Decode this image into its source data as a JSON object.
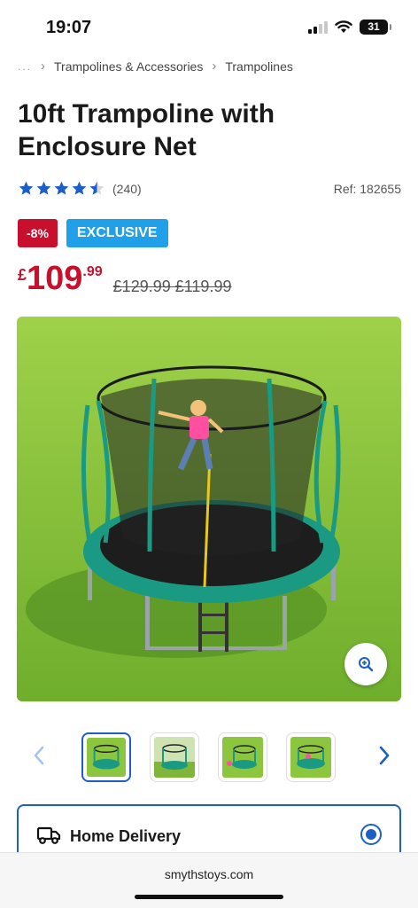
{
  "status": {
    "time": "19:07",
    "battery": "31"
  },
  "breadcrumb": {
    "ellipsis": "...",
    "items": [
      "Trampolines & Accessories",
      "Trampolines"
    ]
  },
  "product": {
    "title": "10ft Trampoline with Enclosure Net",
    "rating_value": 4.5,
    "rating_count": "(240)",
    "ref": "Ref: 182655",
    "badge_discount": "-8%",
    "badge_exclusive": "EXCLUSIVE",
    "price": {
      "currency": "£",
      "pounds": "109",
      "pence": ".99"
    },
    "old_prices": "£129.99 £119.99"
  },
  "gallery": {
    "thumbnail_count": 4,
    "active_index": 0
  },
  "delivery": {
    "label": "Home Delivery",
    "selected": true
  },
  "browser": {
    "url": "smythstoys.com"
  },
  "colors": {
    "accent_red": "#c8102e",
    "accent_blue": "#1d5fc4",
    "exclusive_blue": "#1fa0e8",
    "star_blue": "#1d5fc4"
  }
}
